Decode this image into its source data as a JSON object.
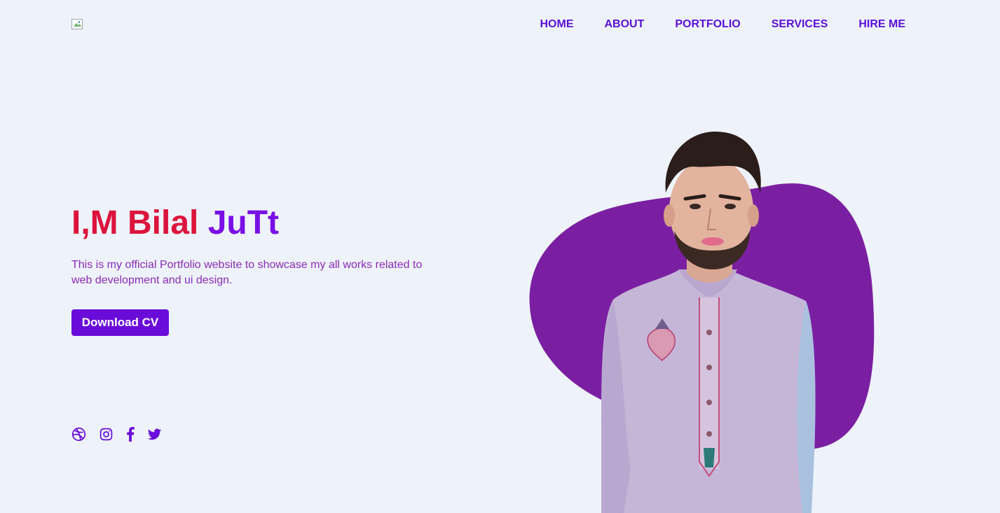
{
  "header": {
    "logo_alt": "logo",
    "nav": [
      "HOME",
      "ABOUT",
      "PORTFOLIO",
      "SERVICES",
      "HIRE ME"
    ]
  },
  "hero": {
    "title_first": "I,M Bilal",
    "title_last": "JuTt",
    "description": "This is my official Portfolio website to showcase my all works related to web development and ui design.",
    "cta_label": "Download CV"
  },
  "social": {
    "icons": [
      "dribbble-icon",
      "instagram-icon",
      "facebook-icon",
      "twitter-icon"
    ]
  },
  "colors": {
    "background": "#eef3fb",
    "nav": "#5b0fd6",
    "title_first": "#dc143c",
    "title_last": "#7a0ee6",
    "description": "#8a2ab8",
    "button": "#6a0cd9",
    "blob": "#7b1fa2"
  }
}
